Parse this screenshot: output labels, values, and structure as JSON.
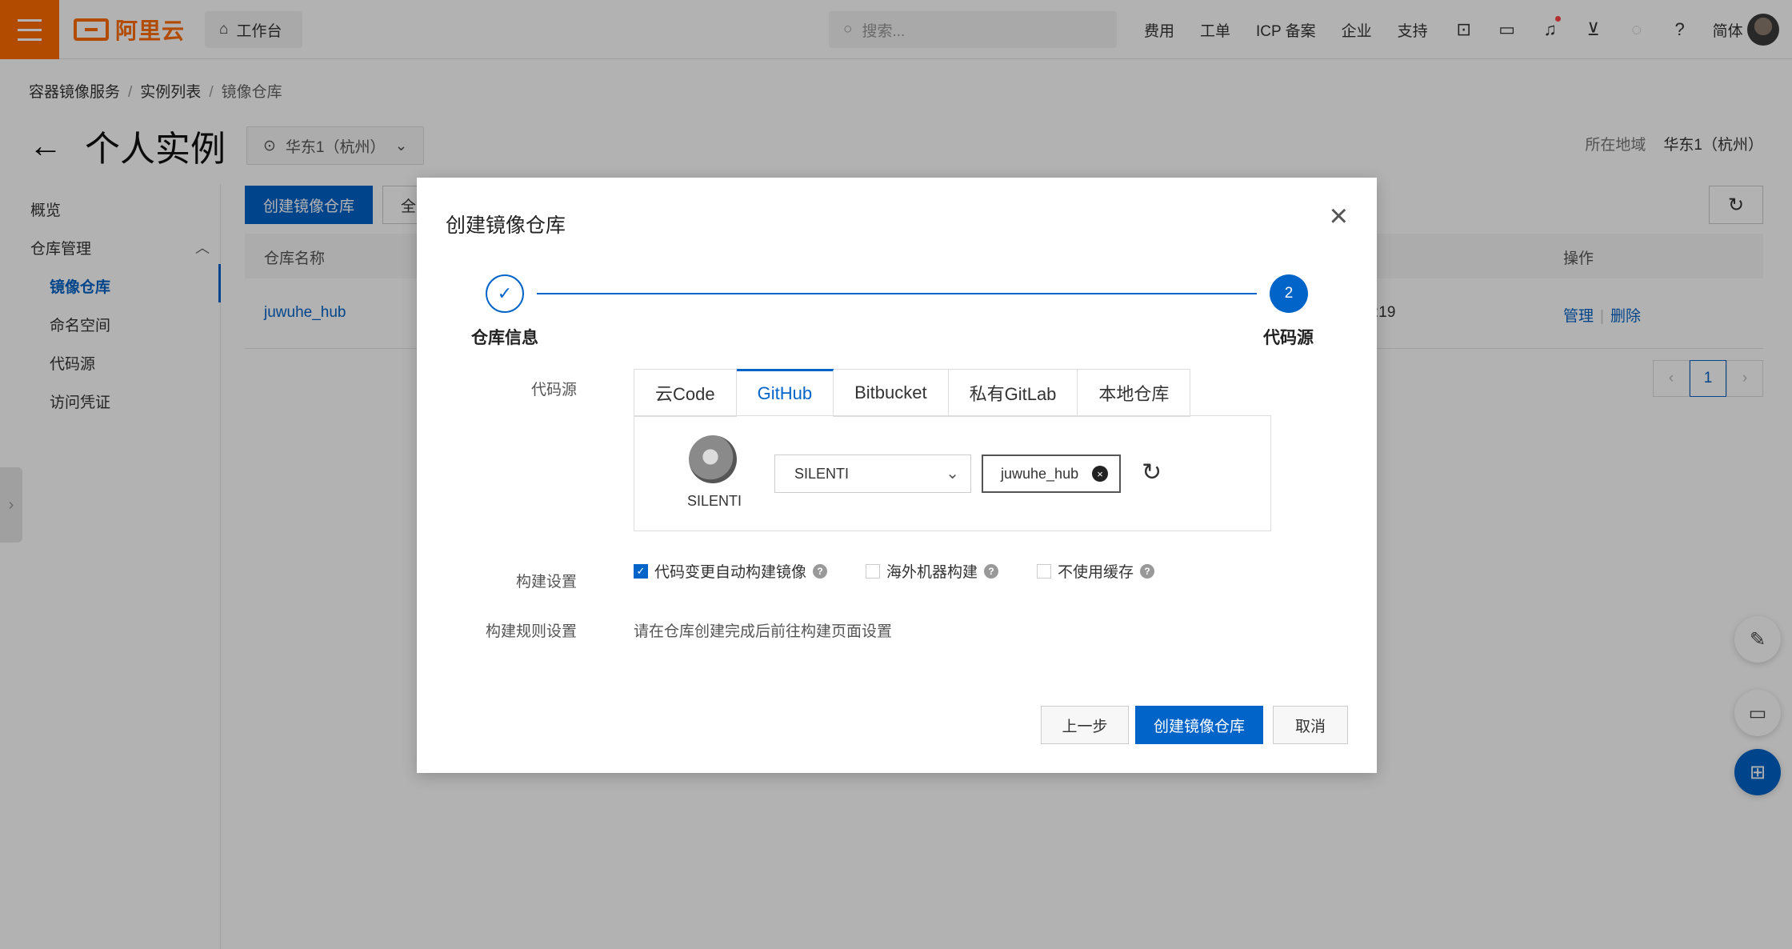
{
  "topbar": {
    "logo_text": "阿里云",
    "workbench": "工作台",
    "search_placeholder": "搜索...",
    "nav": [
      "费用",
      "工单",
      "ICP 备案",
      "企业",
      "支持"
    ],
    "lang": "简体"
  },
  "breadcrumb": [
    "容器镜像服务",
    "实例列表",
    "镜像仓库"
  ],
  "page": {
    "title": "个人实例",
    "region_select": "华东1（杭州）",
    "region_label": "所在地域",
    "region_value": "华东1（杭州）"
  },
  "sidebar": {
    "overview": "概览",
    "repo_mgmt": "仓库管理",
    "items": [
      "镜像仓库",
      "命名空间",
      "代码源",
      "访问凭证"
    ]
  },
  "main": {
    "create_button": "创建镜像仓库",
    "filter_button": "全",
    "col_name": "仓库名称",
    "col_ops": "操作",
    "row": {
      "name": "juwuhe_hub",
      "time_fragment": ":19",
      "manage": "管理",
      "delete": "删除"
    },
    "page": "1"
  },
  "dialog": {
    "title": "创建镜像仓库",
    "steps": [
      {
        "label": "仓库信息"
      },
      {
        "number": "2",
        "label": "代码源"
      }
    ],
    "source_label": "代码源",
    "tabs": [
      "云Code",
      "GitHub",
      "Bitbucket",
      "私有GitLab",
      "本地仓库"
    ],
    "active_tab": "GitHub",
    "github_user": "SILENTI",
    "namespace_value": "SILENTI",
    "repo_value": "juwuhe_hub",
    "build_label": "构建设置",
    "build_options": [
      {
        "label": "代码变更自动构建镜像",
        "checked": true
      },
      {
        "label": "海外机器构建",
        "checked": false
      },
      {
        "label": "不使用缓存",
        "checked": false
      }
    ],
    "rule_label": "构建规则设置",
    "rule_text": "请在仓库创建完成后前往构建页面设置",
    "btn_prev": "上一步",
    "btn_submit": "创建镜像仓库",
    "btn_cancel": "取消"
  },
  "colors": {
    "brand": "#ff6a00",
    "primary": "#0064c8"
  }
}
